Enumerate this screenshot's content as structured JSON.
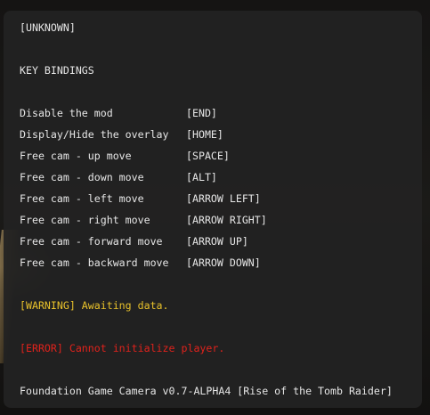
{
  "overlay": {
    "profile_label": "[UNKNOWN]",
    "key_bindings_title": "KEY BINDINGS",
    "bindings": [
      {
        "action": "Disable the mod",
        "key": "[END]"
      },
      {
        "action": "Display/Hide the overlay",
        "key": "[HOME]"
      },
      {
        "action": "Free cam - up move",
        "key": "[SPACE]"
      },
      {
        "action": "Free cam - down move",
        "key": "[ALT]"
      },
      {
        "action": "Free cam - left move",
        "key": "[ARROW LEFT]"
      },
      {
        "action": "Free cam - right move",
        "key": "[ARROW RIGHT]"
      },
      {
        "action": "Free cam - forward move",
        "key": "[ARROW UP]"
      },
      {
        "action": "Free cam - backward move",
        "key": "[ARROW DOWN]"
      }
    ],
    "warning_message": "[WARNING] Awaiting data.",
    "error_message": "[ERROR] Cannot initialize player.",
    "footer_title": "Foundation Game Camera v0.7-ALPHA4 [Rise of the Tomb Raider]"
  },
  "colors": {
    "panel_background": "#222222",
    "text": "#e6e6e6",
    "warning": "#e8c12b",
    "error": "#e0221c"
  }
}
